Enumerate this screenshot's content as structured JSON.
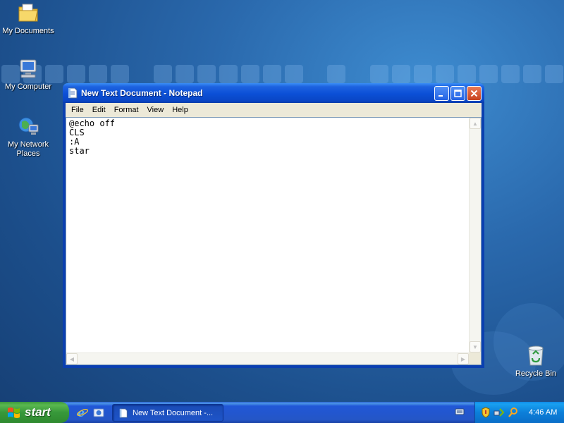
{
  "desktop": {
    "icons": [
      {
        "label": "My Documents",
        "icon": "folder-icon"
      },
      {
        "label": "My Computer",
        "icon": "computer-icon"
      },
      {
        "label": "My Network Places",
        "icon": "network-icon"
      },
      {
        "label": "Recycle Bin",
        "icon": "recycle-bin-icon"
      }
    ]
  },
  "window": {
    "title": "New Text Document - Notepad",
    "menu": [
      "File",
      "Edit",
      "Format",
      "View",
      "Help"
    ],
    "content": "@echo off\nCLS\n:A\nstar"
  },
  "taskbar": {
    "start_label": "start",
    "task_label": "New Text Document -...",
    "clock": "4:46 AM"
  },
  "colors": {
    "titlebar": "#0b4fd6",
    "taskbar": "#2456c6",
    "start_button": "#37983a",
    "tray": "#0c7fd9"
  }
}
